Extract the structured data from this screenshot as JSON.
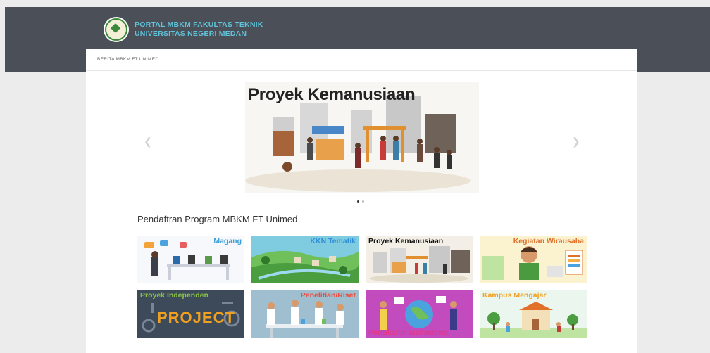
{
  "header": {
    "brand_line1": "PORTAL MBKM FAKULTAS TEKNIK",
    "brand_line2": "UNIVERSITAS NEGERI MEDAN"
  },
  "breadcrumb": "BERITA MBKM FT UNIMED",
  "carousel": {
    "prev_icon": "chevron-left-icon",
    "next_icon": "chevron-right-icon",
    "slide_title": "Proyek Kemanusiaan",
    "slide_count": 2,
    "active_slide": 1
  },
  "section": {
    "title": "Pendaftran Program MBKM FT Unimed"
  },
  "programs": [
    {
      "label": "Magang",
      "color": "#3a9fd8"
    },
    {
      "label": "KKN Tematik",
      "color": "#2f8fd6"
    },
    {
      "label": "Proyek Kemanusiaan",
      "color": "#111111"
    },
    {
      "label": "Kegiatan Wirausaha",
      "color": "#e0702a"
    },
    {
      "label": "Proyek Independen",
      "color": "#8bc34a"
    },
    {
      "label": "Penelitian/Riset",
      "color": "#e94c3c"
    },
    {
      "label": "Pertukaran Mahasiswa",
      "color": "#e0398f"
    },
    {
      "label": "Kampus Mengajar",
      "color": "#f0a020"
    }
  ],
  "project_word": "PROJECT"
}
